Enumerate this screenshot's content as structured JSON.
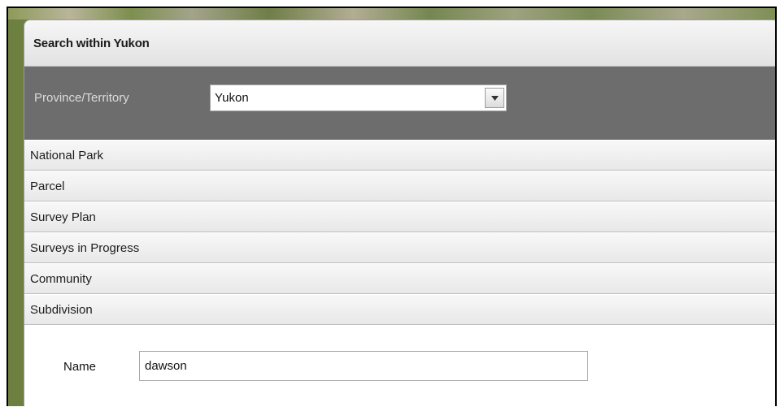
{
  "dialog": {
    "title": "Search within Yukon"
  },
  "province": {
    "label": "Province/Territory",
    "selected": "Yukon"
  },
  "accordion": {
    "items": [
      {
        "label": "National Park"
      },
      {
        "label": "Parcel"
      },
      {
        "label": "Survey Plan"
      },
      {
        "label": "Surveys in Progress"
      },
      {
        "label": "Community"
      },
      {
        "label": "Subdivision"
      }
    ]
  },
  "subdivision": {
    "name_label": "Name",
    "name_value": "dawson"
  }
}
